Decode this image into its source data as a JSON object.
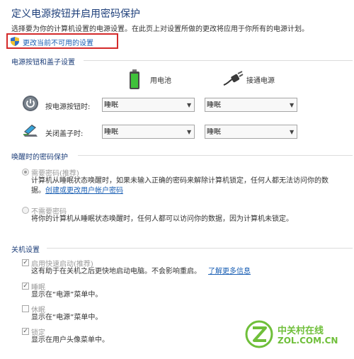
{
  "page": {
    "title": "定义电源按钮并启用密码保护",
    "description": "选择要为你的计算机设置的电源设置。在此页上对设置所做的更改将应用于你所有的电源计划。",
    "change_link": "更改当前不可用的设置"
  },
  "power_buttons": {
    "section_title": "电源按钮和盖子设置",
    "battery_label": "用电池",
    "plugged_label": "接通电源",
    "rows": [
      {
        "label": "按电源按钮时:",
        "battery_value": "睡眠",
        "plugged_value": "睡眠"
      },
      {
        "label": "关闭盖子时:",
        "battery_value": "睡眠",
        "plugged_value": "睡眠"
      }
    ]
  },
  "wake_password": {
    "section_title": "唤醒时的密码保护",
    "options": [
      {
        "label": "需要密码(推荐)",
        "selected": true,
        "desc_line1": "计算机从睡眠状态唤醒时，如果未输入正确的密码来解除计算机锁定，任何人都无法访问你的数",
        "desc_line2": "据。",
        "link": "创建或更改用户帐户密码"
      },
      {
        "label": "不需要密码",
        "selected": false,
        "desc_line1": "将你的计算机从睡眠状态唤醒时，任何人都可以访问你的数据，因为计算机未锁定。"
      }
    ]
  },
  "shutdown": {
    "section_title": "关机设置",
    "items": [
      {
        "label": "启用快速启动(推荐)",
        "checked": true,
        "desc": "这有助于在关机之后更快地启动电脑。不会影响重启。",
        "link": "了解更多信息"
      },
      {
        "label": "睡眠",
        "checked": true,
        "desc": "显示在“电源”菜单中。"
      },
      {
        "label": "休眠",
        "checked": false,
        "desc": "显示在“电源”菜单中。"
      },
      {
        "label": "锁定",
        "checked": true,
        "desc": "显示在用户头像菜单中。"
      }
    ]
  },
  "watermark": {
    "brand_cn": "中关村在线",
    "brand_en": "ZOL.COM.CN"
  },
  "colors": {
    "accent_blue": "#1e3f7a",
    "link_blue": "#1a5fb4",
    "highlight_red": "#d42a2a",
    "watermark_green": "#6fbf3a"
  }
}
